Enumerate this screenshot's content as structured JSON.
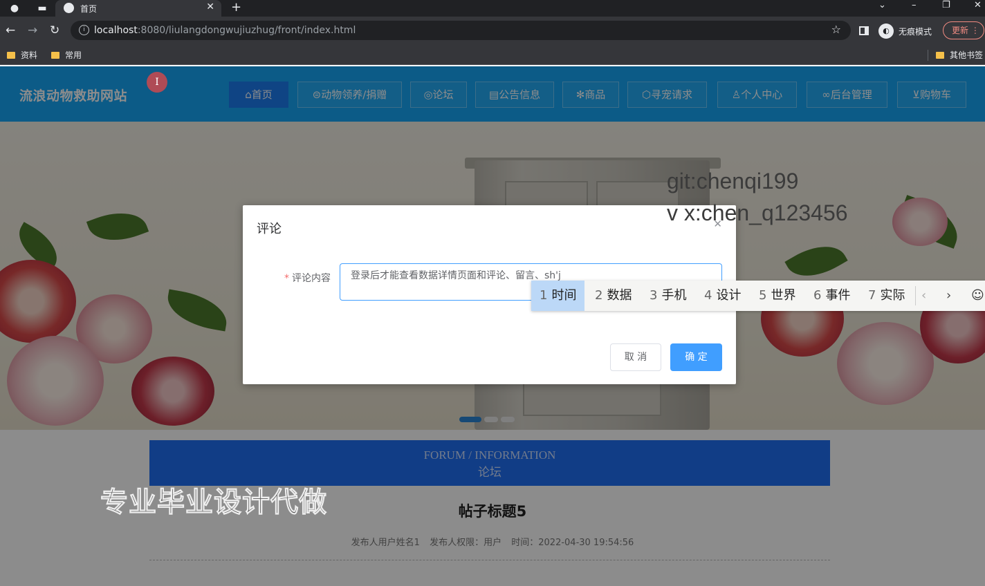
{
  "browser": {
    "tab_title": "首页",
    "url_host": "localhost",
    "url_rest": ":8080/liulangdongwujiuzhug/front/index.html",
    "incognito_label": "无痕模式",
    "update_label": "更新",
    "bookmarks": [
      "资料",
      "常用",
      "其他书签"
    ]
  },
  "site": {
    "title": "流浪动物救助网站",
    "nav": [
      {
        "label": "首页",
        "icon": "home-icon"
      },
      {
        "label": "动物领养/捐赠",
        "icon": "paw-icon"
      },
      {
        "label": "论坛",
        "icon": "compass-icon"
      },
      {
        "label": "公告信息",
        "icon": "notice-icon"
      },
      {
        "label": "商品",
        "icon": "snowflake-icon"
      },
      {
        "label": "寻宠请求",
        "icon": "cube-icon"
      },
      {
        "label": "个人中心",
        "icon": "user-icon"
      },
      {
        "label": "后台管理",
        "icon": "link-icon"
      },
      {
        "label": "购物车",
        "icon": "cart-icon"
      }
    ]
  },
  "watermark": {
    "line1": "git:chenqi199",
    "line2": "v x:chen_q123456"
  },
  "forum": {
    "en": "FORUM / INFORMATION",
    "zh": "论坛"
  },
  "post": {
    "title": "帖子标题5",
    "author": "发布人用户姓名1",
    "role": "发布人权限：用户",
    "time": "时间：2022-04-30 19:54:56"
  },
  "promo": "专业毕业设计代做",
  "dialog": {
    "title": "评论",
    "label": "评论内容",
    "value": "登录后才能查看数据详情页面和评论、留言、sh'j",
    "cancel": "取 消",
    "confirm": "确 定"
  },
  "ime": {
    "candidates": [
      {
        "n": "1",
        "w": "时间"
      },
      {
        "n": "2",
        "w": "数据"
      },
      {
        "n": "3",
        "w": "手机"
      },
      {
        "n": "4",
        "w": "设计"
      },
      {
        "n": "5",
        "w": "世界"
      },
      {
        "n": "6",
        "w": "事件"
      },
      {
        "n": "7",
        "w": "实际"
      }
    ]
  }
}
